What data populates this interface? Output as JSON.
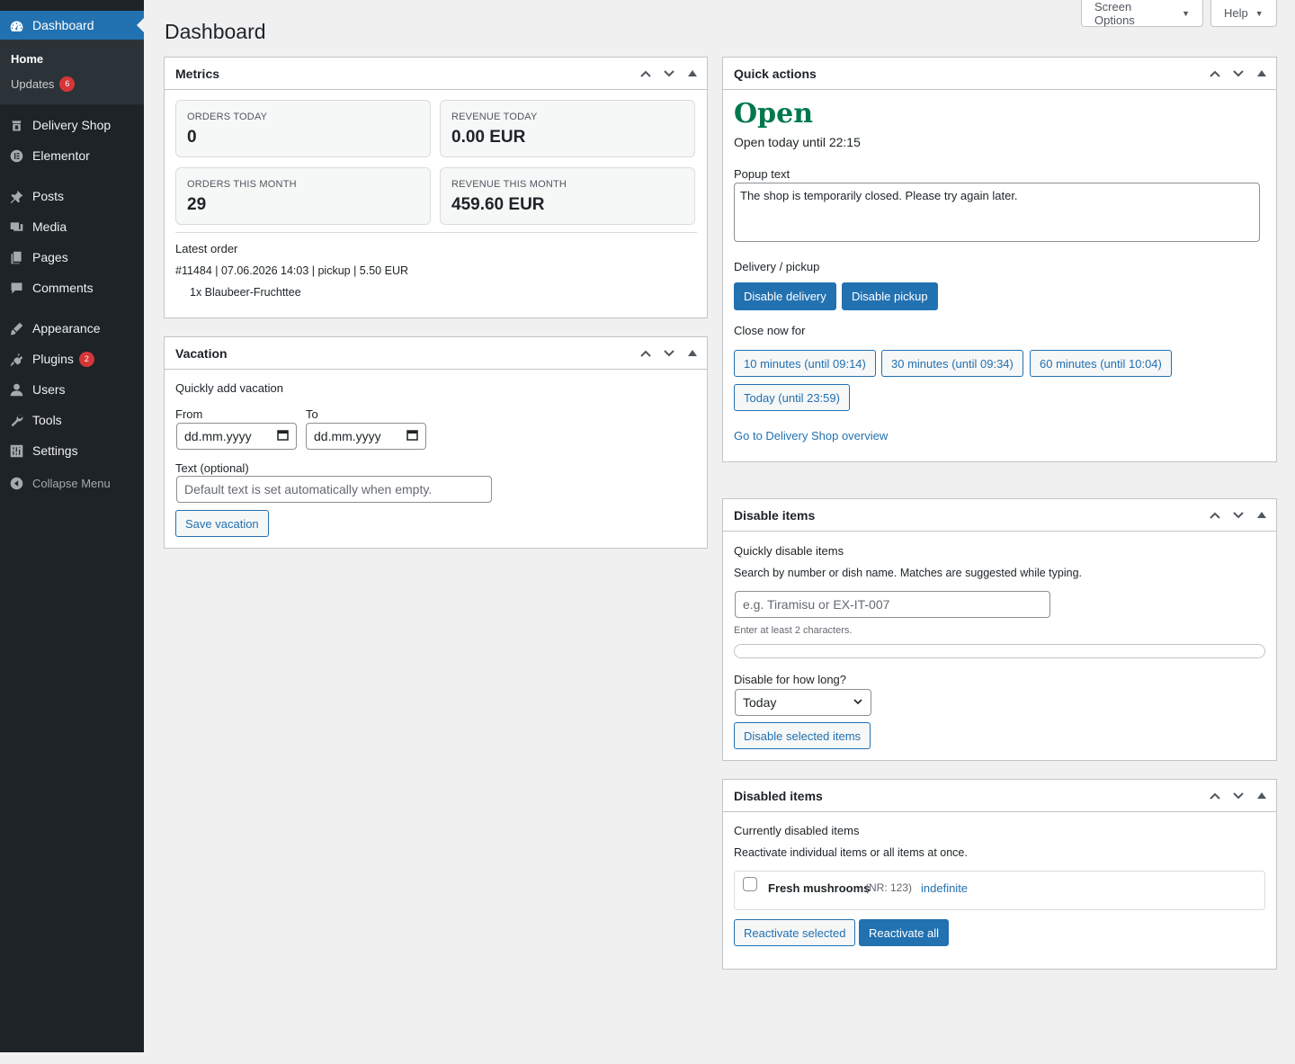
{
  "sidebar": {
    "dashboard": "Dashboard",
    "sub_home": "Home",
    "sub_updates": "Updates",
    "updates_count": "6",
    "items": [
      {
        "label": "Delivery Shop",
        "icon": "shop-icon"
      },
      {
        "label": "Elementor",
        "icon": "elementor-icon"
      },
      {
        "label": "Posts",
        "icon": "pin-icon"
      },
      {
        "label": "Media",
        "icon": "media-icon"
      },
      {
        "label": "Pages",
        "icon": "pages-icon"
      },
      {
        "label": "Comments",
        "icon": "comment-icon"
      },
      {
        "label": "Appearance",
        "icon": "brush-icon"
      },
      {
        "label": "Plugins",
        "icon": "plugin-icon"
      },
      {
        "label": "Users",
        "icon": "user-icon"
      },
      {
        "label": "Tools",
        "icon": "wrench-icon"
      },
      {
        "label": "Settings",
        "icon": "sliders-icon"
      }
    ],
    "plugins_count": "2",
    "collapse": "Collapse Menu"
  },
  "top": {
    "screen_options": "Screen Options",
    "help": "Help",
    "page_title": "Dashboard"
  },
  "metrics": {
    "title": "Metrics",
    "orders_today_label": "ORDERS TODAY",
    "orders_today": "0",
    "revenue_today_label": "REVENUE TODAY",
    "revenue_today": "0.00 EUR",
    "orders_month_label": "ORDERS THIS MONTH",
    "orders_month": "29",
    "revenue_month_label": "REVENUE THIS MONTH",
    "revenue_month": "459.60 EUR",
    "latest_label": "Latest order",
    "latest_line": "#11484 | 07.06.2026 14:03 | pickup | 5.50 EUR",
    "latest_item": "1x Blaubeer-Fruchttee"
  },
  "vacation": {
    "title": "Vacation",
    "subtitle": "Quickly add vacation",
    "from_label": "From",
    "to_label": "To",
    "date_placeholder": "dd.mm.yyyy",
    "text_label": "Text (optional)",
    "text_placeholder": "Default text is set automatically when empty.",
    "save": "Save vacation"
  },
  "quick": {
    "title": "Quick actions",
    "status": "Open",
    "status_color": "#00784b",
    "status_sub": "Open today until 22:15",
    "popup_label": "Popup text",
    "popup_text": "The shop is temporarily closed. Please try again later.",
    "delivery_label": "Delivery / pickup",
    "disable_delivery": "Disable delivery",
    "disable_pickup": "Disable pickup",
    "close_label": "Close now for",
    "close_10": "10 minutes (until 09:14)",
    "close_30": "30 minutes (until 09:34)",
    "close_60": "60 minutes (until 10:04)",
    "close_today": "Today (until 23:59)",
    "overview_link": "Go to Delivery Shop overview"
  },
  "disable_items": {
    "title": "Disable items",
    "subtitle": "Quickly disable items",
    "desc": "Search by number or dish name. Matches are suggested while typing.",
    "search_placeholder": "e.g. Tiramisu or EX-IT-007",
    "hint": "Enter at least 2 characters.",
    "duration_label": "Disable for how long?",
    "duration_value": "Today",
    "disable_btn": "Disable selected items"
  },
  "disabled_items": {
    "title": "Disabled items",
    "subtitle": "Currently disabled items",
    "desc": "Reactivate individual items or all items at once.",
    "items": [
      {
        "name": "Fresh mushrooms",
        "nr": "(NR: 123)",
        "duration": "indefinite"
      }
    ],
    "reactivate_selected": "Reactivate selected",
    "reactivate_all": "Reactivate all"
  }
}
